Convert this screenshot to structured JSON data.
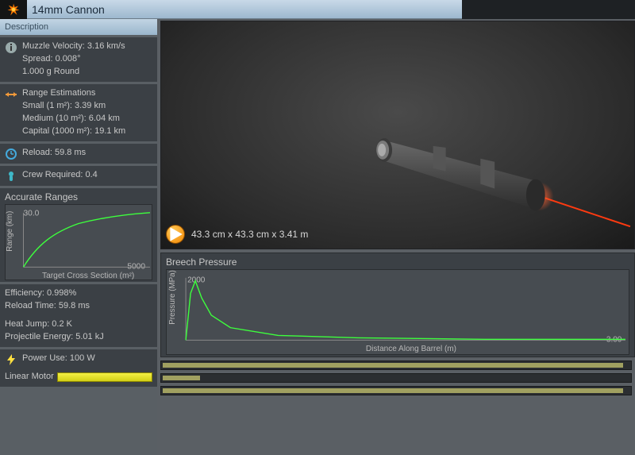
{
  "title": "14mm Cannon",
  "tab": "Description",
  "stats": {
    "muzzle_velocity": "Muzzle Velocity: 3.16 km/s",
    "spread": "Spread: 0.008°",
    "round": "1.000 g Round",
    "range_header": "Range Estimations",
    "range_small": "Small (1 m²): 3.39 km",
    "range_medium": "Medium (10 m²): 6.04 km",
    "range_capital": "Capital (1000 m²): 19.1 km",
    "reload": "Reload: 59.8 ms",
    "crew": "Crew Required: 0.4"
  },
  "accurate_ranges": {
    "title": "Accurate Ranges",
    "y_max": "30.0",
    "x_max": "5000",
    "y_label": "Range (km)",
    "x_label": "Target Cross Section (m²)"
  },
  "eff": {
    "efficiency": "Efficiency: 0.998%",
    "reload_time": "Reload Time: 59.8 ms",
    "heat_jump": "Heat Jump: 0.2 K",
    "proj_energy": "Projectile Energy: 5.01 kJ"
  },
  "power": {
    "use": "Power Use: 100 W",
    "motor": "Linear Motor"
  },
  "viewport": {
    "dimensions": "43.3 cm x 43.3 cm x 3.41 m"
  },
  "pressure": {
    "title": "Breech Pressure",
    "y_max": "2000",
    "x_max": "3.00",
    "y_label": "Pressure (MPa)",
    "x_label": "Distance Along Barrel (m)"
  },
  "chart_data": [
    {
      "type": "line",
      "title": "Accurate Ranges",
      "xlabel": "Target Cross Section (m²)",
      "ylabel": "Range (km)",
      "xlim": [
        0,
        5000
      ],
      "ylim": [
        0,
        30
      ],
      "x": [
        0,
        200,
        500,
        1000,
        2000,
        3000,
        4000,
        5000
      ],
      "values": [
        0,
        9,
        15,
        19,
        24,
        27,
        29,
        30
      ]
    },
    {
      "type": "line",
      "title": "Breech Pressure",
      "xlabel": "Distance Along Barrel (m)",
      "ylabel": "Pressure (MPa)",
      "xlim": [
        0,
        3.0
      ],
      "ylim": [
        0,
        2000
      ],
      "x": [
        0.0,
        0.05,
        0.1,
        0.15,
        0.2,
        0.3,
        0.5,
        0.8,
        1.2,
        1.8,
        2.4,
        3.0
      ],
      "values": [
        0,
        1800,
        2000,
        1400,
        900,
        500,
        250,
        130,
        70,
        35,
        20,
        12
      ]
    }
  ]
}
